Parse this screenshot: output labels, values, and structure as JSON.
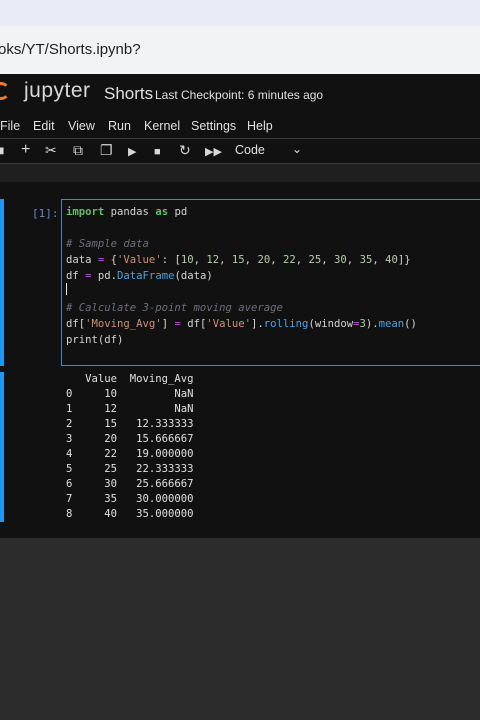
{
  "browser": {
    "url": "oks/YT/Shorts.ipynb?"
  },
  "header": {
    "logo_text": "jupyter",
    "notebook_title": "Shorts",
    "checkpoint": "Last Checkpoint: 6 minutes ago",
    "accent_color": "#f37726"
  },
  "menu": [
    "File",
    "Edit",
    "View",
    "Run",
    "Kernel",
    "Settings",
    "Help"
  ],
  "toolbar": {
    "icons": [
      "save-icon",
      "add-icon",
      "cut-icon",
      "copy-icon",
      "paste-icon",
      "run-icon",
      "stop-icon",
      "restart-icon",
      "fast-forward-icon"
    ],
    "cell_type": "Code"
  },
  "cell": {
    "prompt": "[1]:",
    "code_lines": [
      "import pandas as pd",
      "",
      "# Sample data",
      "data = {'Value': [10, 12, 15, 20, 22, 25, 30, 35, 40]}",
      "df = pd.DataFrame(data)",
      "",
      "# Calculate 3-point moving average",
      "df['Moving_Avg'] = df['Value'].rolling(window=3).mean()",
      "print(df)"
    ],
    "output_lines": [
      "   Value  Moving_Avg",
      "0     10         NaN",
      "1     12         NaN",
      "2     15   12.333333",
      "3     20   15.666667",
      "4     22   19.000000",
      "5     25   22.333333",
      "6     30   25.666667",
      "7     35   30.000000",
      "8     40   35.000000"
    ],
    "active_color": "#2196f3"
  }
}
